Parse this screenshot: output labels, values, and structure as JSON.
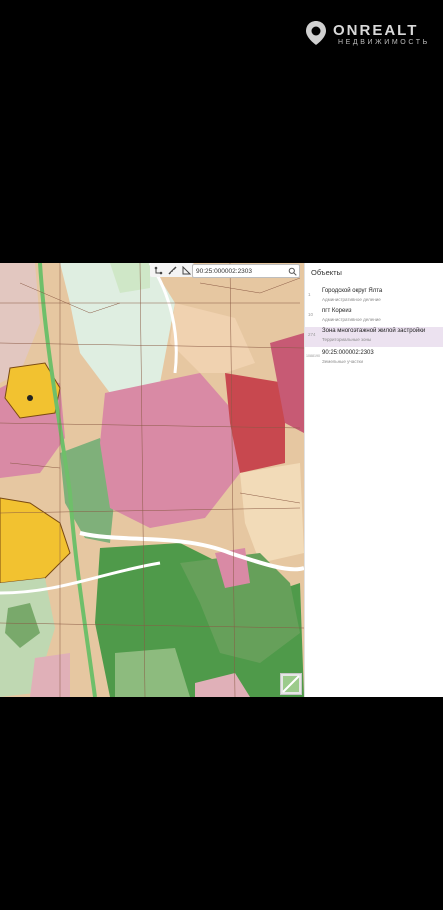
{
  "watermark": {
    "brand": "ONREALT",
    "sub": "НЕДВИЖИМОСТЬ"
  },
  "map": {
    "search_value": "90:25:000002:2303",
    "tools": [
      "route-tool-icon",
      "ruler-icon",
      "angle-icon"
    ],
    "zone_colors": {
      "residential": "#d98aa5",
      "business": "#c8484f",
      "forest": "#4f9a4a",
      "park": "#8dbb7e",
      "agri": "#f2c230",
      "mixed": "#e6c7a1",
      "roads": "#ffffff"
    }
  },
  "panel": {
    "title": "Объекты",
    "items": [
      {
        "num": "1",
        "name": "Городской округ Ялта",
        "type": "Административное деление"
      },
      {
        "num": "10",
        "name": "пгт Кореиз",
        "type": "Административное деление"
      },
      {
        "num": "274",
        "name": "Зона многоэтажной жилой застройки",
        "type": "Территориальные зоны"
      },
      {
        "num": "1088190",
        "name": "90:25:000002:2303",
        "type": "Земельные участки"
      }
    ]
  }
}
